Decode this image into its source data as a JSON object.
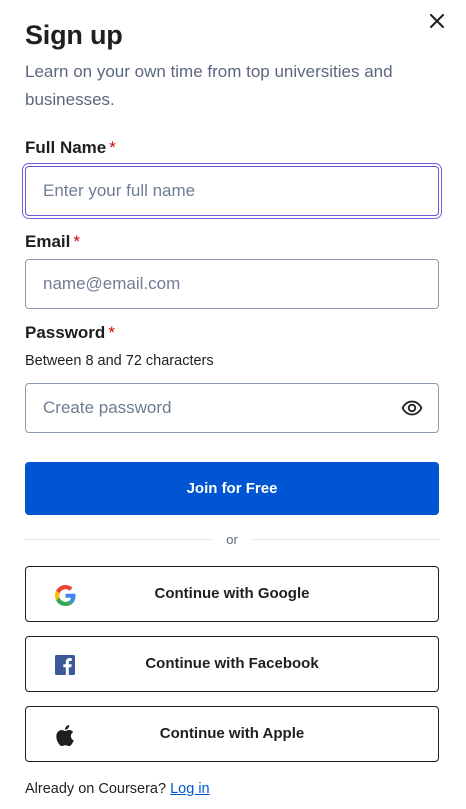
{
  "dialog": {
    "title": "Sign up",
    "subtitle": "Learn on your own time from top universities and businesses.",
    "close_icon": "close-icon"
  },
  "form": {
    "full_name": {
      "label": "Full Name",
      "required_mark": "*",
      "placeholder": "Enter your full name",
      "value": "",
      "focused": true
    },
    "email": {
      "label": "Email",
      "required_mark": "*",
      "placeholder": "name@email.com",
      "value": ""
    },
    "password": {
      "label": "Password",
      "required_mark": "*",
      "hint": "Between 8 and 72 characters",
      "placeholder": "Create password",
      "value": "",
      "toggle_icon": "eye-icon"
    },
    "submit_label": "Join for Free"
  },
  "divider_text": "or",
  "social": [
    {
      "label": "Continue with Google",
      "icon": "google-icon"
    },
    {
      "label": "Continue with Facebook",
      "icon": "facebook-icon"
    },
    {
      "label": "Continue with Apple",
      "icon": "apple-icon"
    }
  ],
  "footer": {
    "prompt": "Already on Coursera?",
    "login_label": "Log in"
  },
  "colors": {
    "primary": "#0056d2",
    "focus_ring": "#7a5ae6",
    "required": "#d30001",
    "facebook": "#1877f2"
  }
}
